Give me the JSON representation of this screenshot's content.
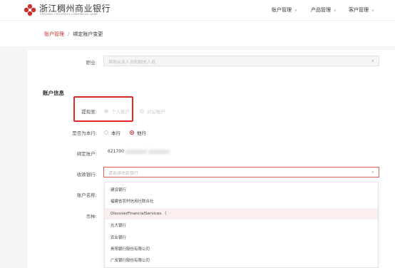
{
  "header": {
    "logo_cn": "浙江稠州商业银行",
    "logo_en": "ZHEJIANG CHOUZHOU COMMERCIAL BANK",
    "nav": [
      "账户管理",
      "产品管理",
      "客户管理"
    ]
  },
  "breadcrumb": {
    "parent": "账户管理",
    "separator": "/",
    "current": "绑定账户变更"
  },
  "form": {
    "job_label": "职业:",
    "job_value": "其他从业人员和相关人员",
    "section_title": "账户信息",
    "withdraw_label": "提现至:",
    "withdraw_options": [
      "个人账户",
      "对公账户"
    ],
    "same_bank_label": "是否为本行:",
    "same_bank_options": [
      "本行",
      "他行"
    ],
    "bind_account_label": "绑定账户:",
    "bind_account_value": "621700",
    "receive_bank_label": "收款银行:",
    "receive_bank_placeholder": "请选择收款银行",
    "account_name_label": "账户名称:",
    "currency_label": "币种:"
  },
  "dropdown": {
    "options": [
      "建设银行",
      "福建省农村信用社联合社",
      "DiscoverFinancialServices.（",
      "光大银行",
      "农业银行",
      "贵阳银行股份有限公司",
      "广发银行股份有限公司"
    ],
    "hover_index": 2
  }
}
